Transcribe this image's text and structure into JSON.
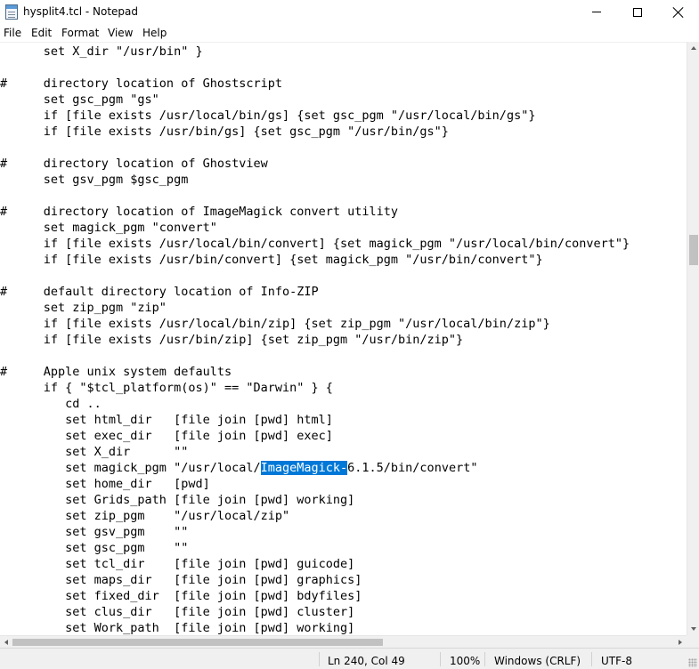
{
  "window": {
    "title": "hysplit4.tcl - Notepad",
    "icon": "notepad-icon",
    "controls": [
      "minimize-icon",
      "maximize-icon",
      "close-icon"
    ]
  },
  "menu": [
    "File",
    "Edit",
    "Format",
    "View",
    "Help"
  ],
  "editor": {
    "lines": [
      "      set X_dir \"/usr/bin\" }",
      "",
      "#     directory location of Ghostscript",
      "      set gsc_pgm \"gs\"",
      "      if [file exists /usr/local/bin/gs] {set gsc_pgm \"/usr/local/bin/gs\"}",
      "      if [file exists /usr/bin/gs] {set gsc_pgm \"/usr/bin/gs\"}",
      "",
      "#     directory location of Ghostview",
      "      set gsv_pgm $gsc_pgm",
      "",
      "#     directory location of ImageMagick convert utility",
      "      set magick_pgm \"convert\"",
      "      if [file exists /usr/local/bin/convert] {set magick_pgm \"/usr/local/bin/convert\"}",
      "      if [file exists /usr/bin/convert] {set magick_pgm \"/usr/bin/convert\"}",
      "",
      "#     default directory location of Info-ZIP",
      "      set zip_pgm \"zip\"",
      "      if [file exists /usr/local/bin/zip] {set zip_pgm \"/usr/local/bin/zip\"}",
      "      if [file exists /usr/bin/zip] {set zip_pgm \"/usr/bin/zip\"}",
      "",
      "#     Apple unix system defaults",
      "      if { \"$tcl_platform(os)\" == \"Darwin\" } {",
      "         cd ..",
      "         set html_dir   [file join [pwd] html]",
      "         set exec_dir   [file join [pwd] exec]",
      "         set X_dir      \"\"",
      "         set magick_pgm \"/usr/local/ImageMagick-6.1.5/bin/convert\"",
      "         set home_dir   [pwd]",
      "         set Grids_path [file join [pwd] working]",
      "         set zip_pgm    \"/usr/local/zip\"",
      "         set gsv_pgm    \"\"",
      "         set gsc_pgm    \"\"",
      "         set tcl_dir    [file join [pwd] guicode]",
      "         set maps_dir   [file join [pwd] graphics]",
      "         set fixed_dir  [file join [pwd] bdyfiles]",
      "         set clus_dir   [file join [pwd] cluster]",
      "         set Work_path  [file join [pwd] working]"
    ],
    "selection": {
      "line": 26,
      "before": "         set magick_pgm \"/usr/local/",
      "selected": "ImageMagick-",
      "after": "6.1.5/bin/convert\"",
      "color": "#0078d7"
    }
  },
  "status": {
    "position": "Ln 240, Col 49",
    "zoom": "100%",
    "line_ending": "Windows (CRLF)",
    "encoding": "UTF-8"
  }
}
